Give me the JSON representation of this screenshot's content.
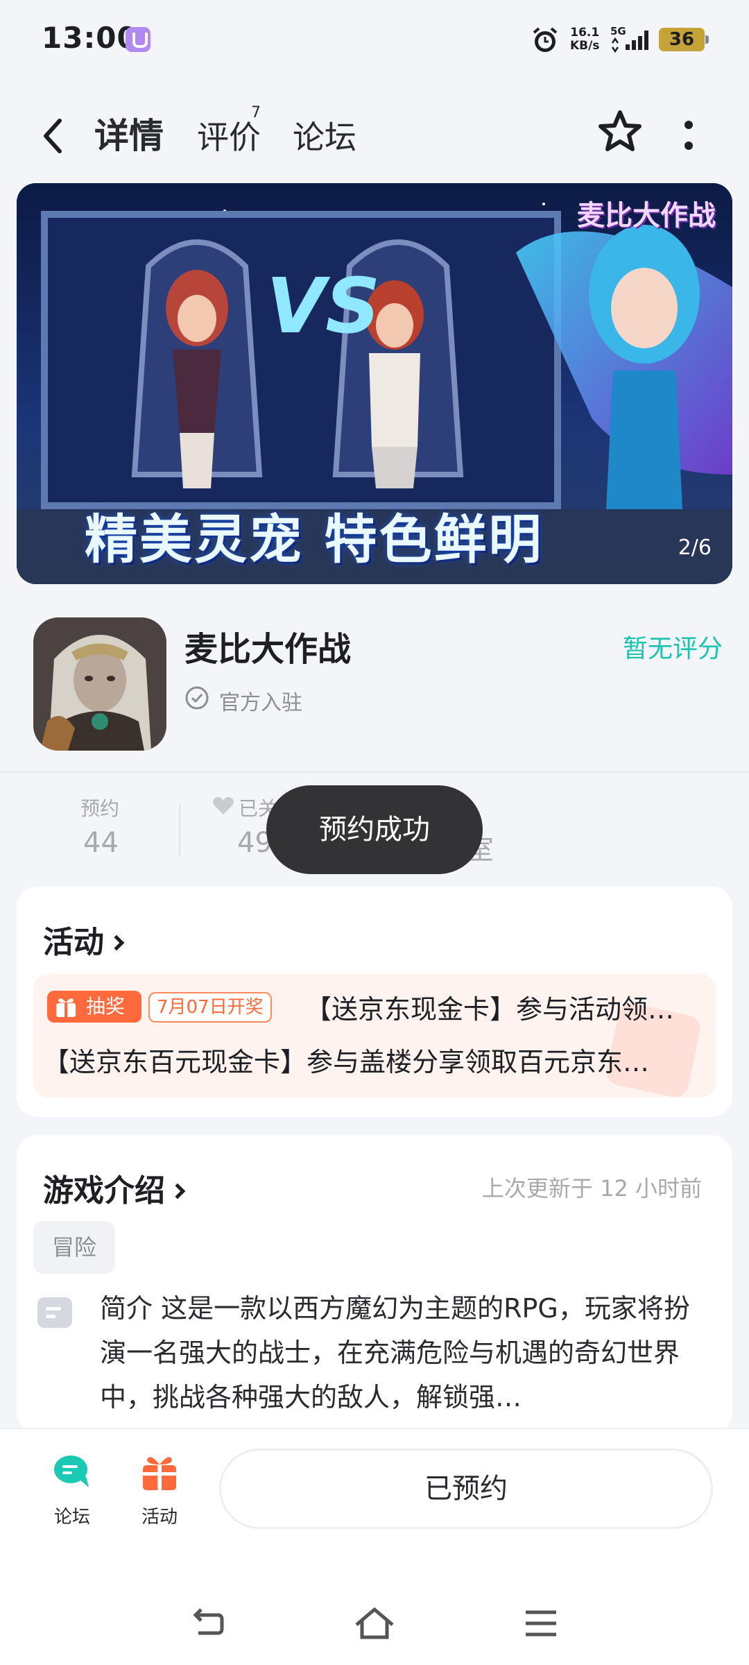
{
  "status_bar": {
    "time": "13:00",
    "net_speed_value": "16.1",
    "net_speed_unit": "KB/s",
    "network_type": "5G",
    "battery": "36"
  },
  "header": {
    "tabs": [
      {
        "label": "详情",
        "active": true
      },
      {
        "label": "评价",
        "count": "7"
      },
      {
        "label": "论坛"
      }
    ]
  },
  "banner": {
    "caption": "精美灵宠 特色鲜明",
    "logo_text": "麦比大作战",
    "counter": "2/6"
  },
  "game": {
    "title": "麦比大作战",
    "verified_label": "官方入驻",
    "rating": "暂无评分"
  },
  "stats": {
    "reservations_label": "预约",
    "reservations_value": "44",
    "followed_label": "已关",
    "followed_value": "49",
    "third_value": "室"
  },
  "toast": "预约成功",
  "activity": {
    "title": "活动",
    "badge": "抽奖",
    "date": "7月07日开奖",
    "line1": "【送京东现金卡】参与活动领…",
    "line2": "【送京东百元现金卡】参与盖楼分享领取百元京东…"
  },
  "intro": {
    "title": "游戏介绍",
    "updated": "上次更新于 12 小时前",
    "tag": "冒险",
    "text": "简介 这是一款以西方魔幻为主题的RPG，玩家将扮演一名强大的战士，在充满危险与机遇的奇幻世界中，挑战各种强大的敌人，解锁强…"
  },
  "bottom_bar": {
    "forum_label": "论坛",
    "activity_label": "活动",
    "reserved_label": "已预约"
  },
  "colors": {
    "accent": "#1fd0bb",
    "orange": "#ff6a3d",
    "toast_bg": "#333335"
  },
  "icons": [
    "back-icon",
    "star-icon",
    "more-icon",
    "verified-icon",
    "heart-icon",
    "gift-icon",
    "forum-icon",
    "doc-icon"
  ]
}
